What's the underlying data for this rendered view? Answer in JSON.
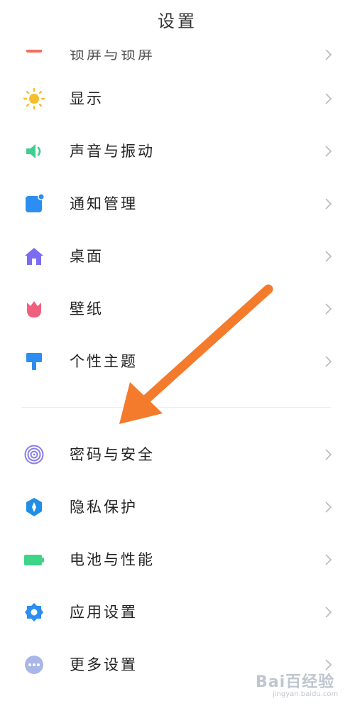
{
  "header": {
    "title": "设置"
  },
  "items": [
    {
      "label": "锁屏与锁屏",
      "icon": "lock-screen-icon",
      "color": "#f2705f"
    },
    {
      "label": "显示",
      "icon": "sun-icon",
      "color": "#f7bd2a"
    },
    {
      "label": "声音与振动",
      "icon": "speaker-icon",
      "color": "#3ecf8e"
    },
    {
      "label": "通知管理",
      "icon": "notification-icon",
      "color": "#2b8ef0"
    },
    {
      "label": "桌面",
      "icon": "home-icon",
      "color": "#7b6cf2"
    },
    {
      "label": "壁纸",
      "icon": "tulip-icon",
      "color": "#ef5f7e"
    },
    {
      "label": "个性主题",
      "icon": "paintbrush-icon",
      "color": "#2b8ef0"
    },
    {
      "label": "密码与安全",
      "icon": "fingerprint-icon",
      "color": "#8a7de8"
    },
    {
      "label": "隐私保护",
      "icon": "shield-icon",
      "color": "#1f8fe6"
    },
    {
      "label": "电池与性能",
      "icon": "battery-icon",
      "color": "#3ed48a"
    },
    {
      "label": "应用设置",
      "icon": "gear-icon",
      "color": "#2b8ef0"
    },
    {
      "label": "更多设置",
      "icon": "more-icon",
      "color": "#a9b6e8"
    }
  ],
  "annotation": {
    "arrow_color": "#f47a2c"
  },
  "watermark": {
    "text": "Bai百经验",
    "sub": "jingyan.baidu.com"
  }
}
